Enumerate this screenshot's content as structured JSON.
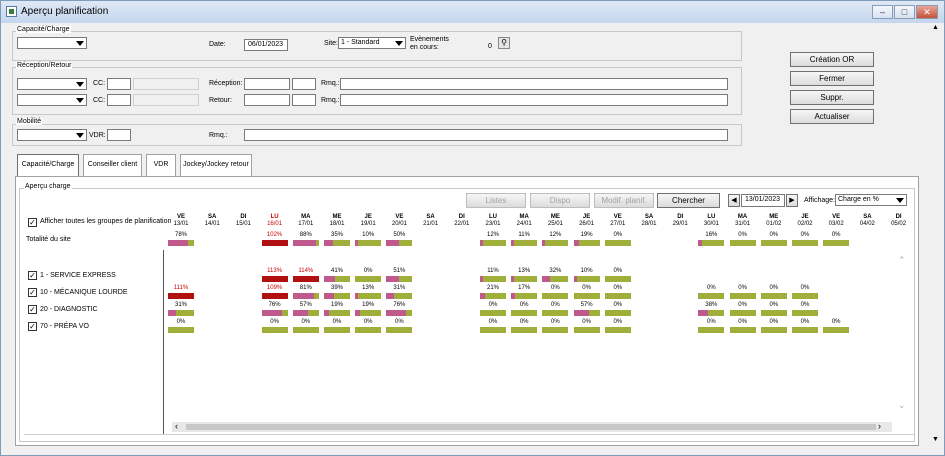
{
  "window": {
    "title": "Aperçu planification",
    "min": "–",
    "max": "□",
    "close": "✕"
  },
  "capacite": {
    "legend": "Capacité/Charge",
    "date_label": "Date:",
    "date_value": "06/01/2023",
    "site_label": "Site:",
    "site_value": "1 - Standard",
    "events_label": "Evènements en cours:",
    "events_value": "0"
  },
  "reception": {
    "legend": "Réception/Retour",
    "cc_label": "CC:",
    "cc2_label": "CC:",
    "reception_label": "Réception:",
    "retour_label": "Retour:",
    "rmq_label": "Rmq.:",
    "rmq2_label": "Rmq.:"
  },
  "mobilite": {
    "legend": "Mobilité",
    "vdr_label": "VDR:",
    "rmq_label": "Rmq.:"
  },
  "actions": {
    "creation": "Création OR",
    "fermer": "Fermer",
    "suppr": "Suppr.",
    "actualiser": "Actualiser"
  },
  "tabs": [
    "Capacité/Charge",
    "Conseiller client",
    "VDR",
    "Jockey/Jockey retour"
  ],
  "apercu": {
    "legend": "Aperçu charge",
    "listes": "Listes",
    "dispo": "Dispo",
    "modif": "Modif. planif.",
    "chercher": "Chercher",
    "nav_date": "13/01/2023",
    "affichage_label": "Affichage:",
    "affichage_value": "Charge en %",
    "show_all": "Afficher toutes les groupes de planification",
    "total_label": "Totalité du site",
    "prev": "◀",
    "next": "▶"
  },
  "days": [
    {
      "d": "VE",
      "n": "13/01"
    },
    {
      "d": "SA",
      "n": "14/01"
    },
    {
      "d": "DI",
      "n": "15/01"
    },
    {
      "d": "LU",
      "n": "16/01",
      "red": true
    },
    {
      "d": "MA",
      "n": "17/01"
    },
    {
      "d": "ME",
      "n": "18/01"
    },
    {
      "d": "JE",
      "n": "19/01"
    },
    {
      "d": "VE",
      "n": "20/01"
    },
    {
      "d": "SA",
      "n": "21/01"
    },
    {
      "d": "DI",
      "n": "22/01"
    },
    {
      "d": "LU",
      "n": "23/01"
    },
    {
      "d": "MA",
      "n": "24/01"
    },
    {
      "d": "ME",
      "n": "25/01"
    },
    {
      "d": "JE",
      "n": "26/01"
    },
    {
      "d": "VE",
      "n": "27/01"
    },
    {
      "d": "SA",
      "n": "28/01"
    },
    {
      "d": "DI",
      "n": "29/01"
    },
    {
      "d": "LU",
      "n": "30/01"
    },
    {
      "d": "MA",
      "n": "31/01"
    },
    {
      "d": "ME",
      "n": "01/02"
    },
    {
      "d": "JE",
      "n": "02/02"
    },
    {
      "d": "VE",
      "n": "03/02"
    },
    {
      "d": "SA",
      "n": "04/02"
    },
    {
      "d": "DI",
      "n": "05/02"
    }
  ],
  "rows": [
    {
      "label": "Totalité du site",
      "check": false,
      "values": [
        "78%",
        "",
        "",
        "102%",
        "88%",
        "35%",
        "10%",
        "50%",
        "",
        "",
        "12%",
        "11%",
        "12%",
        "19%",
        "0%",
        "",
        "",
        "16%",
        "0%",
        "0%",
        "0%",
        "0%",
        "",
        ""
      ]
    },
    {
      "label": "1 - SERVICE EXPRESS",
      "check": true,
      "values": [
        "",
        "",
        "",
        "113%",
        "114%",
        "41%",
        "0%",
        "51%",
        "",
        "",
        "11%",
        "13%",
        "32%",
        "10%",
        "0%",
        "",
        "",
        "",
        "",
        "",
        "",
        "",
        "",
        ""
      ]
    },
    {
      "label": "10 - MÉCANIQUE LOURDE",
      "check": true,
      "values": [
        "111%",
        "",
        "",
        "109%",
        "81%",
        "39%",
        "13%",
        "31%",
        "",
        "",
        "21%",
        "17%",
        "0%",
        "0%",
        "0%",
        "",
        "",
        "0%",
        "0%",
        "0%",
        "0%",
        "",
        "",
        ""
      ]
    },
    {
      "label": "20 - DIAGNOSTIC",
      "check": true,
      "values": [
        "31%",
        "",
        "",
        "76%",
        "57%",
        "19%",
        "19%",
        "76%",
        "",
        "",
        "0%",
        "0%",
        "0%",
        "57%",
        "0%",
        "",
        "",
        "38%",
        "0%",
        "0%",
        "0%",
        "",
        "",
        ""
      ]
    },
    {
      "label": "70 - PRÉPA VO",
      "check": true,
      "values": [
        "0%",
        "",
        "",
        "0%",
        "0%",
        "0%",
        "0%",
        "0%",
        "",
        "",
        "0%",
        "0%",
        "0%",
        "0%",
        "0%",
        "",
        "",
        "0%",
        "0%",
        "0%",
        "0%",
        "0%",
        "",
        ""
      ]
    }
  ],
  "colors": {
    "green": "#a0ae3a",
    "pink": "#c05a8c",
    "red": "#b01010",
    "gray": "#b0b0b0"
  }
}
